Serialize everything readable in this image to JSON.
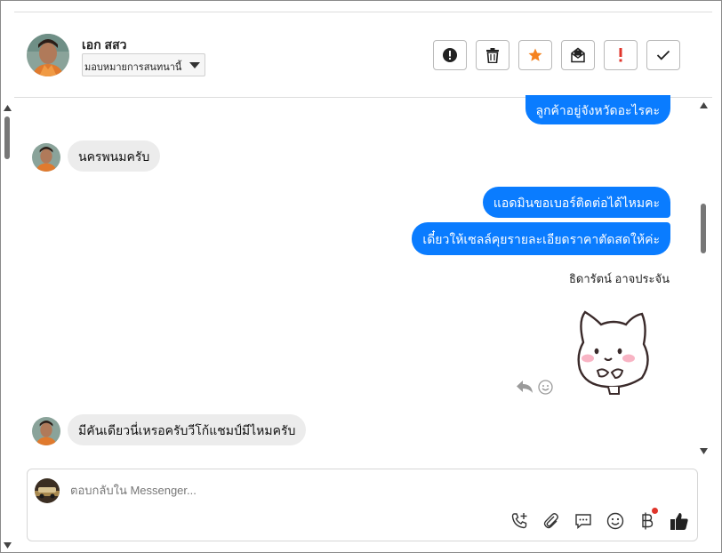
{
  "header": {
    "contact_name": "เอก สสว",
    "assign_label": "มอบหมายการสนทนานี้",
    "toolbar": {
      "spam_icon": "alert-circle-icon",
      "delete_icon": "trash-icon",
      "star_icon": "star-icon",
      "mark_unread_icon": "envelope-icon",
      "important_icon": "exclamation-icon",
      "done_icon": "check-icon"
    }
  },
  "messages": {
    "out_1": "ลูกค้าอยู่จังหวัดอะไรคะ",
    "in_1": "นครพนมครับ",
    "out_2": "แอดมินขอเบอร์ติดต่อได้ไหมคะ",
    "out_3": "เดี๋ยวให้เซลล์คุยรายละเอียดราคาตัดสดให้ค่ะ",
    "sender_name": "ธิดารัตน์ อาจประจัน",
    "in_2": "มีคันเดียวนี่เหรอครับวีโก้แชมป์มีไหมครับ"
  },
  "composer": {
    "placeholder": "ตอบกลับใน Messenger...",
    "icons": [
      "phone-plus-icon",
      "paperclip-icon",
      "chat-bubble-icon",
      "smiley-icon",
      "baht-icon",
      "thumbs-up-icon"
    ]
  },
  "colors": {
    "outgoing_bubble": "#0a7cff",
    "incoming_bubble": "#ececec",
    "star": "#f5821f",
    "alert_red": "#e0352b"
  }
}
